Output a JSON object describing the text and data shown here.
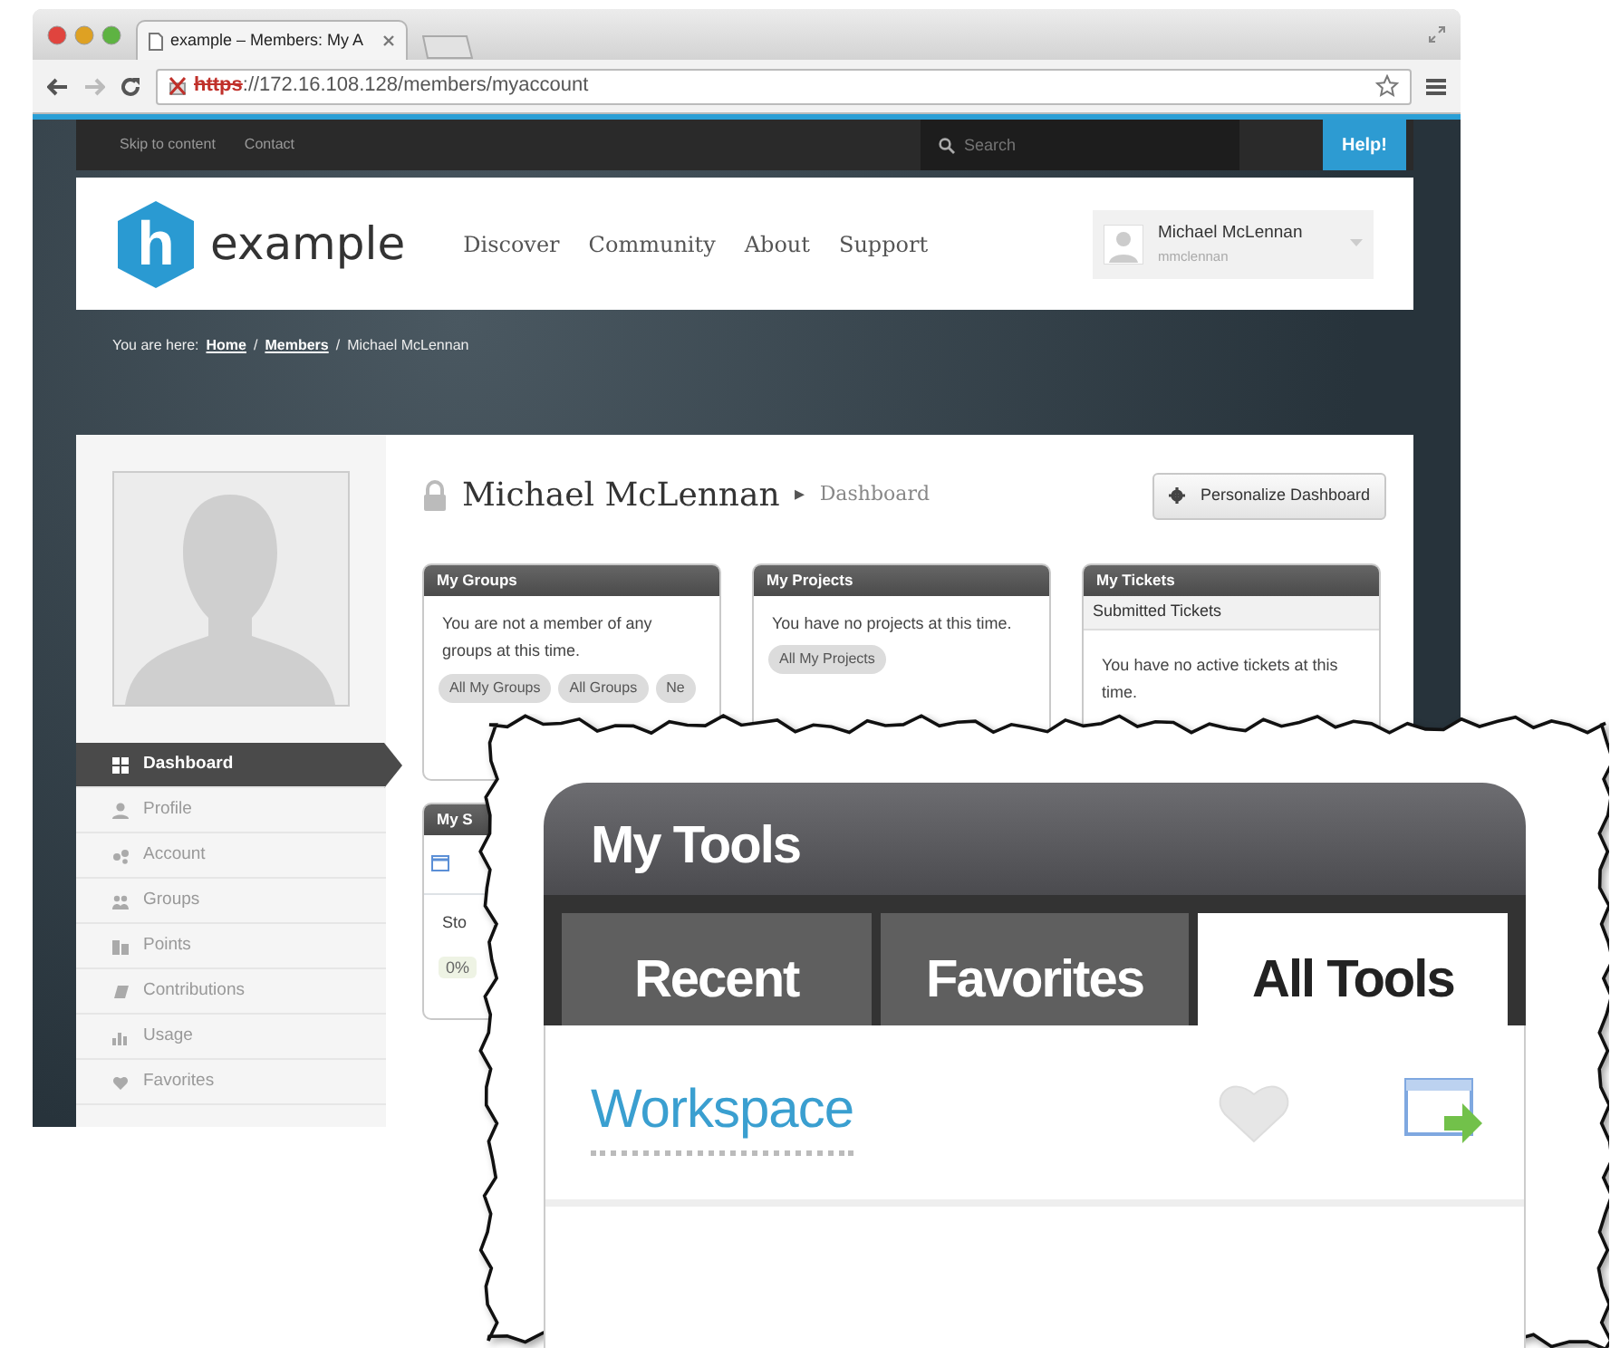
{
  "browser": {
    "tab_title": "example – Members: My A",
    "url": {
      "scheme": "https",
      "rest": "://172.16.108.128/members/myaccount"
    }
  },
  "topbar": {
    "links": [
      "Skip to content",
      "Contact"
    ],
    "search": {
      "placeholder": "Search"
    },
    "help": "Help!"
  },
  "header": {
    "logo_letter": "h",
    "logo_text": "example",
    "nav": [
      "Discover",
      "Community",
      "About",
      "Support"
    ],
    "user": {
      "name": "Michael McLennan",
      "username": "mmclennan"
    }
  },
  "breadcrumb": {
    "prefix": "You are here:",
    "separator": "/",
    "items": [
      {
        "label": "Home",
        "link": true
      },
      {
        "label": "Members",
        "link": true
      },
      {
        "label": "Michael McLennan",
        "link": false
      }
    ]
  },
  "profile": {
    "name": "Michael McLennan",
    "arrow": "▸",
    "section": "Dashboard",
    "button": "Personalize Dashboard"
  },
  "sidebar": {
    "items": [
      {
        "label": "Dashboard",
        "selected": true
      },
      {
        "label": "Profile",
        "selected": false
      },
      {
        "label": "Account",
        "selected": false
      },
      {
        "label": "Groups",
        "selected": false
      },
      {
        "label": "Points",
        "selected": false
      },
      {
        "label": "Contributions",
        "selected": false
      },
      {
        "label": "Usage",
        "selected": false
      },
      {
        "label": "Favorites",
        "selected": false
      }
    ]
  },
  "modules": [
    {
      "title": "My Groups",
      "text": "You are not a member of any groups at this time.",
      "buttons": [
        "All My Groups",
        "All Groups",
        "Ne"
      ]
    },
    {
      "title": "My Projects",
      "text": "You have no projects at this time.",
      "buttons": [
        "All My Projects"
      ]
    },
    {
      "title": "My Tickets",
      "subheader": "Submitted Tickets",
      "text": "You have no active tickets at this time."
    },
    {
      "title": "My S",
      "calendar": true,
      "text": "Sto",
      "badge": "0%"
    }
  ],
  "callout": {
    "title": "My Tools",
    "tabs": [
      {
        "label": "Recent",
        "selected": false
      },
      {
        "label": "Favorites",
        "selected": false
      },
      {
        "label": "All Tools",
        "selected": true
      }
    ],
    "tools": [
      {
        "name": "Workspace",
        "favorite": false
      }
    ]
  }
}
